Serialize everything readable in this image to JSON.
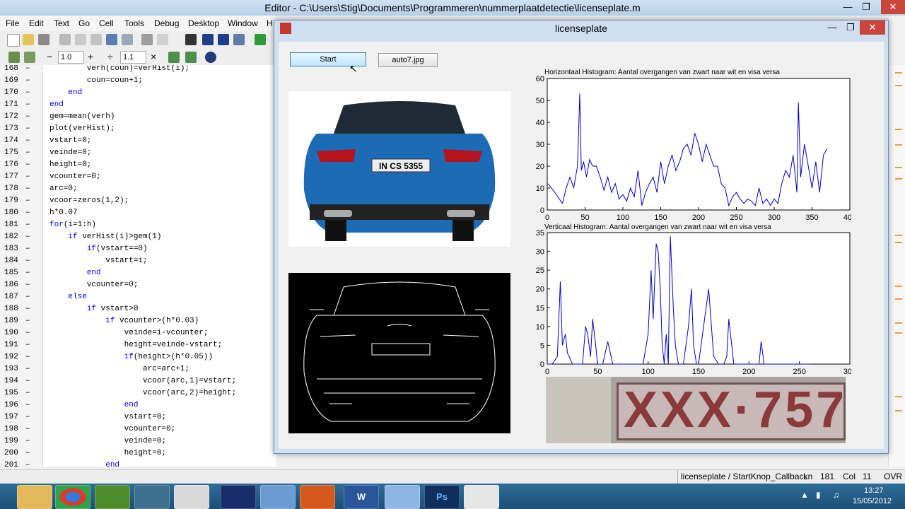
{
  "editor": {
    "title": "Editor - C:\\Users\\Stig\\Documents\\Programmeren\\nummerplaatdetectie\\licenseplate.m",
    "menu": [
      "File",
      "Edit",
      "Text",
      "Go",
      "Cell",
      "Tools",
      "Debug",
      "Desktop",
      "Window",
      "H"
    ],
    "toolbar2": {
      "decrement": "−",
      "value1": "1.0",
      "increment": "+",
      "divide": "÷",
      "value2": "1.1",
      "multiply": "×"
    },
    "code_lines": [
      {
        "num": "168",
        "text": "        verh(coun)=verHist(i);"
      },
      {
        "num": "169",
        "text": "        coun=coun+1;"
      },
      {
        "num": "170",
        "text": "    end",
        "kw": true
      },
      {
        "num": "171",
        "text": "end",
        "kw": true
      },
      {
        "num": "172",
        "text": "gem=mean(verh)"
      },
      {
        "num": "173",
        "text": "plot(verHist);"
      },
      {
        "num": "174",
        "text": "vstart=0;"
      },
      {
        "num": "175",
        "text": "veinde=0;"
      },
      {
        "num": "176",
        "text": "height=0;"
      },
      {
        "num": "177",
        "text": "vcounter=0;"
      },
      {
        "num": "178",
        "text": "arc=0;"
      },
      {
        "num": "179",
        "text": "vcoor=zeros(1,2);"
      },
      {
        "num": "180",
        "text": "h*0.07"
      },
      {
        "num": "181",
        "text": "for(i=1:h)",
        "kwprefix": "for"
      },
      {
        "num": "182",
        "text": "    if verHist(i)>gem(1)",
        "kwprefix": "if"
      },
      {
        "num": "183",
        "text": "        if(vstart==0)",
        "kwprefix": "if"
      },
      {
        "num": "184",
        "text": "            vstart=i;"
      },
      {
        "num": "185",
        "text": "        end",
        "kw": true
      },
      {
        "num": "186",
        "text": "        vcounter=0;"
      },
      {
        "num": "187",
        "text": "    else",
        "kw": true
      },
      {
        "num": "188",
        "text": "        if vstart>0",
        "kwprefix": "if"
      },
      {
        "num": "189",
        "text": "            if vcounter>(h*0.03)",
        "kwprefix": "if"
      },
      {
        "num": "190",
        "text": "                veinde=i-vcounter;"
      },
      {
        "num": "191",
        "text": "                height=veinde-vstart;"
      },
      {
        "num": "192",
        "text": "                if(height>(h*0.05))",
        "kwprefix": "if"
      },
      {
        "num": "193",
        "text": "                    arc=arc+1;"
      },
      {
        "num": "194",
        "text": "                    vcoor(arc,1)=vstart;"
      },
      {
        "num": "195",
        "text": "                    vcoor(arc,2)=height;"
      },
      {
        "num": "196",
        "text": "                end",
        "kw": true
      },
      {
        "num": "197",
        "text": "                vstart=0;"
      },
      {
        "num": "198",
        "text": "                vcounter=0;"
      },
      {
        "num": "199",
        "text": "                veinde=0;"
      },
      {
        "num": "200",
        "text": "                height=0;"
      },
      {
        "num": "201",
        "text": "            end",
        "kw": true
      }
    ],
    "status": {
      "function": "licenseplate / StartKnop_Callback",
      "ln_label": "Ln",
      "ln": "181",
      "col_label": "Col",
      "col": "11",
      "mode": "OVR"
    }
  },
  "figure": {
    "title": "licenseplate",
    "start_label": "Start",
    "file_label": "auto7.jpg",
    "plate_text": "IN CS 5355",
    "result_plate_text": "XXX·757"
  },
  "chart_data": [
    {
      "type": "line",
      "title": "Horizontaal Histogram: Aantal overgangen van zwart naar wit en visa versa",
      "xlabel": "",
      "ylabel": "",
      "xlim": [
        0,
        400
      ],
      "ylim": [
        0,
        60
      ],
      "xticks": [
        0,
        50,
        100,
        150,
        200,
        250,
        300,
        350,
        400
      ],
      "yticks": [
        0,
        10,
        20,
        30,
        40,
        50,
        60
      ],
      "grid": false,
      "series": [
        {
          "color": "#0000c8",
          "x": [
            1,
            10,
            20,
            25,
            30,
            35,
            40,
            43,
            45,
            48,
            52,
            56,
            60,
            65,
            70,
            75,
            80,
            85,
            90,
            95,
            100,
            105,
            110,
            115,
            120,
            125,
            130,
            135,
            140,
            145,
            150,
            155,
            160,
            165,
            170,
            175,
            180,
            185,
            190,
            195,
            200,
            205,
            210,
            215,
            220,
            225,
            230,
            235,
            240,
            245,
            250,
            255,
            260,
            265,
            270,
            275,
            280,
            285,
            290,
            295,
            300,
            305,
            310,
            315,
            320,
            325,
            330,
            332,
            335,
            340,
            345,
            350,
            355,
            360,
            365,
            370
          ],
          "y": [
            12,
            8,
            3,
            10,
            15,
            10,
            20,
            53,
            18,
            22,
            15,
            23,
            20,
            20,
            15,
            9,
            15,
            8,
            12,
            5,
            7,
            4,
            10,
            6,
            18,
            2,
            8,
            12,
            15,
            8,
            22,
            12,
            20,
            25,
            18,
            22,
            28,
            30,
            25,
            35,
            30,
            22,
            30,
            25,
            20,
            20,
            12,
            10,
            2,
            6,
            8,
            5,
            3,
            5,
            4,
            2,
            10,
            3,
            5,
            2,
            5,
            3,
            12,
            18,
            15,
            25,
            8,
            49,
            15,
            30,
            20,
            10,
            22,
            8,
            25,
            28
          ]
        }
      ]
    },
    {
      "type": "line",
      "title": "Verticaal Histogram: Aantal overgangen van zwart naar wit en visa versa",
      "xlabel": "",
      "ylabel": "",
      "xlim": [
        0,
        300
      ],
      "ylim": [
        0,
        35
      ],
      "xticks": [
        0,
        50,
        100,
        150,
        200,
        250,
        300
      ],
      "yticks": [
        0,
        5,
        10,
        15,
        20,
        25,
        30,
        35
      ],
      "grid": false,
      "series": [
        {
          "color": "#0000c8",
          "x": [
            0,
            5,
            10,
            13,
            15,
            18,
            20,
            25,
            30,
            35,
            38,
            40,
            43,
            45,
            48,
            50,
            55,
            60,
            65,
            70,
            75,
            80,
            85,
            90,
            95,
            100,
            103,
            105,
            108,
            110,
            112,
            114,
            116,
            118,
            120,
            122,
            125,
            127,
            130,
            135,
            140,
            143,
            145,
            148,
            150,
            155,
            160,
            165,
            170,
            175,
            178,
            180,
            185,
            190,
            195,
            200,
            205,
            210,
            212,
            215,
            220,
            230,
            240,
            250,
            260
          ],
          "y": [
            0,
            0,
            2,
            22,
            5,
            8,
            3,
            0,
            0,
            0,
            10,
            8,
            2,
            12,
            5,
            0,
            0,
            6,
            0,
            0,
            0,
            0,
            0,
            0,
            0,
            8,
            25,
            12,
            32,
            30,
            20,
            5,
            0,
            8,
            0,
            34,
            15,
            5,
            0,
            0,
            10,
            20,
            5,
            0,
            0,
            10,
            20,
            2,
            0,
            0,
            2,
            12,
            0,
            0,
            0,
            0,
            0,
            0,
            6,
            0,
            0,
            0,
            0,
            0,
            0
          ]
        }
      ]
    }
  ],
  "taskbar": {
    "icons": [
      "explorer-icon",
      "chrome-icon",
      "minecraft-icon",
      "remote-icon",
      "search-tool-icon",
      "lingo-icon",
      "control-panel-icon",
      "matlab-icon",
      "word-icon",
      "paint-icon",
      "photoshop-icon",
      "camera-icon"
    ],
    "clock_time": "13:27",
    "clock_date": "15/05/2012",
    "photoshop_label": "Ps",
    "word_label": "W"
  }
}
